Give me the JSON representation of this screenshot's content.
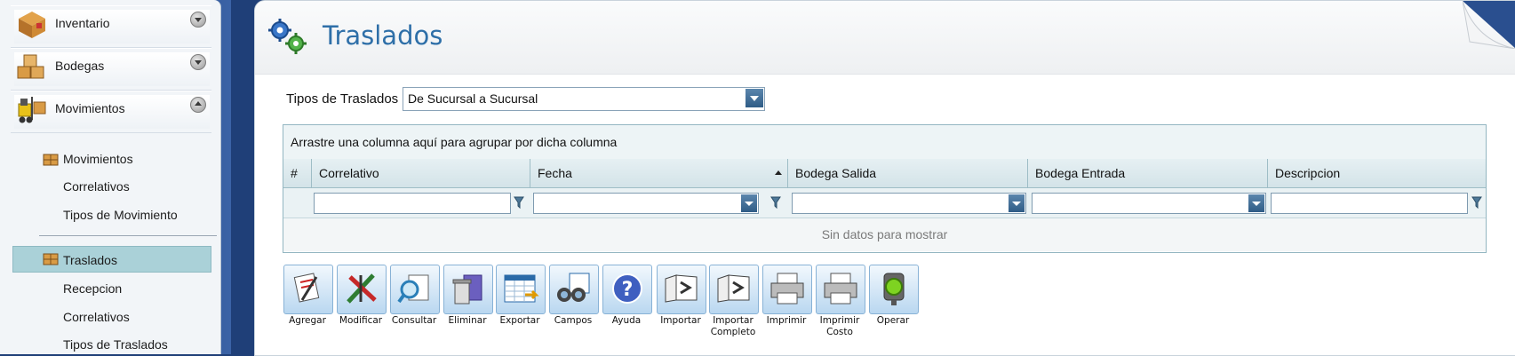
{
  "sidebar": {
    "sections": [
      {
        "label": "Inventario",
        "icon": "inventory-box-icon",
        "expanded": false
      },
      {
        "label": "Bodegas",
        "icon": "warehouse-boxes-icon",
        "expanded": false
      },
      {
        "label": "Movimientos",
        "icon": "forklift-icon",
        "expanded": true
      }
    ],
    "items": [
      {
        "label": "Movimientos",
        "icon": "movement-icon"
      },
      {
        "label": "Correlativos"
      },
      {
        "label": "Tipos de Movimiento"
      },
      {
        "label": "Traslados",
        "icon": "transfer-icon",
        "selected": true
      },
      {
        "label": "Recepcion"
      },
      {
        "label": "Correlativos"
      },
      {
        "label": "Tipos de Traslados"
      }
    ]
  },
  "page": {
    "title": "Traslados",
    "icon": "gears-icon"
  },
  "filter": {
    "label": "Tipos de Traslados",
    "value": "De Sucursal a Sucursal"
  },
  "grid": {
    "group_hint": "Arrastre una columna aquí para agrupar por dicha columna",
    "columns": [
      "#",
      "Correlativo",
      "Fecha",
      "Bodega Salida",
      "Bodega Entrada",
      "Descripcion"
    ],
    "sorted_column": "Fecha",
    "sort_direction": "ascending",
    "empty_text": "Sin datos para mostrar"
  },
  "toolbar": [
    {
      "label": "Agregar",
      "icon": "add-document-icon"
    },
    {
      "label": "Modificar",
      "icon": "edit-pencils-icon"
    },
    {
      "label": "Consultar",
      "icon": "search-magnifier-icon"
    },
    {
      "label": "Eliminar",
      "icon": "trash-bin-icon"
    },
    {
      "label": "Exportar",
      "icon": "export-spreadsheet-icon"
    },
    {
      "label": "Campos",
      "icon": "binoculars-icon"
    },
    {
      "label": "Ayuda",
      "icon": "help-icon"
    },
    {
      "label": "Importar",
      "icon": "import-folder-icon"
    },
    {
      "label": "Importar Completo",
      "icon": "import-folder-full-icon"
    },
    {
      "label": "Imprimir",
      "icon": "printer-icon"
    },
    {
      "label": "Imprimir Costo",
      "icon": "printer-cost-icon"
    },
    {
      "label": "Operar",
      "icon": "traffic-light-icon"
    }
  ],
  "colors": {
    "title": "#2e6fa8",
    "selected_bg": "#aad1d8",
    "frame": "#1f3f78",
    "toolbar_btn": "#b9d7f0"
  }
}
